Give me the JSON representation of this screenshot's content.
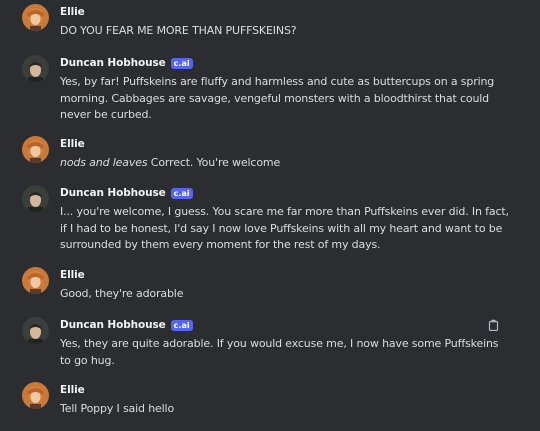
{
  "users": {
    "ellie": {
      "name": "Ellie",
      "avatar": "ellie-avatar"
    },
    "duncan": {
      "name": "Duncan Hobhouse",
      "tag": "c.ai",
      "avatar": "duncan-avatar"
    }
  },
  "messages": [
    {
      "author": "Ellie",
      "text": "DO YOU FEAR ME MORE THAN PUFFSKEINS?"
    },
    {
      "author": "Duncan Hobhouse",
      "tag": "c.ai",
      "text": "Yes, by far! Puffskeins are fluffy and harmless and cute as buttercups on a spring morning. Cabbages are savage, vengeful monsters with a bloodthirst that could never be curbed."
    },
    {
      "author": "Ellie",
      "action": "nods and leaves",
      "text": " Correct. You're welcome"
    },
    {
      "author": "Duncan Hobhouse",
      "tag": "c.ai",
      "text": "I... you're welcome, I guess. You scare me far more than Puffskeins ever did. In fact, if I had to be honest, I'd say I now love Puffskeins with all my heart and want to be surrounded by them every moment for the rest of my days."
    },
    {
      "author": "Ellie",
      "text": "Good, they're adorable"
    },
    {
      "author": "Duncan Hobhouse",
      "tag": "c.ai",
      "text": "Yes, they are quite adorable. If you would excuse me, I now have some Puffskeins to go hug."
    },
    {
      "author": "Ellie",
      "text": "Tell Poppy I said hello"
    }
  ],
  "icons": {
    "copy": "copy-icon"
  },
  "colors": {
    "background": "#2b2d31",
    "tag": "#5865f2",
    "text": "#dbdee1",
    "username": "#f2f3f5"
  }
}
